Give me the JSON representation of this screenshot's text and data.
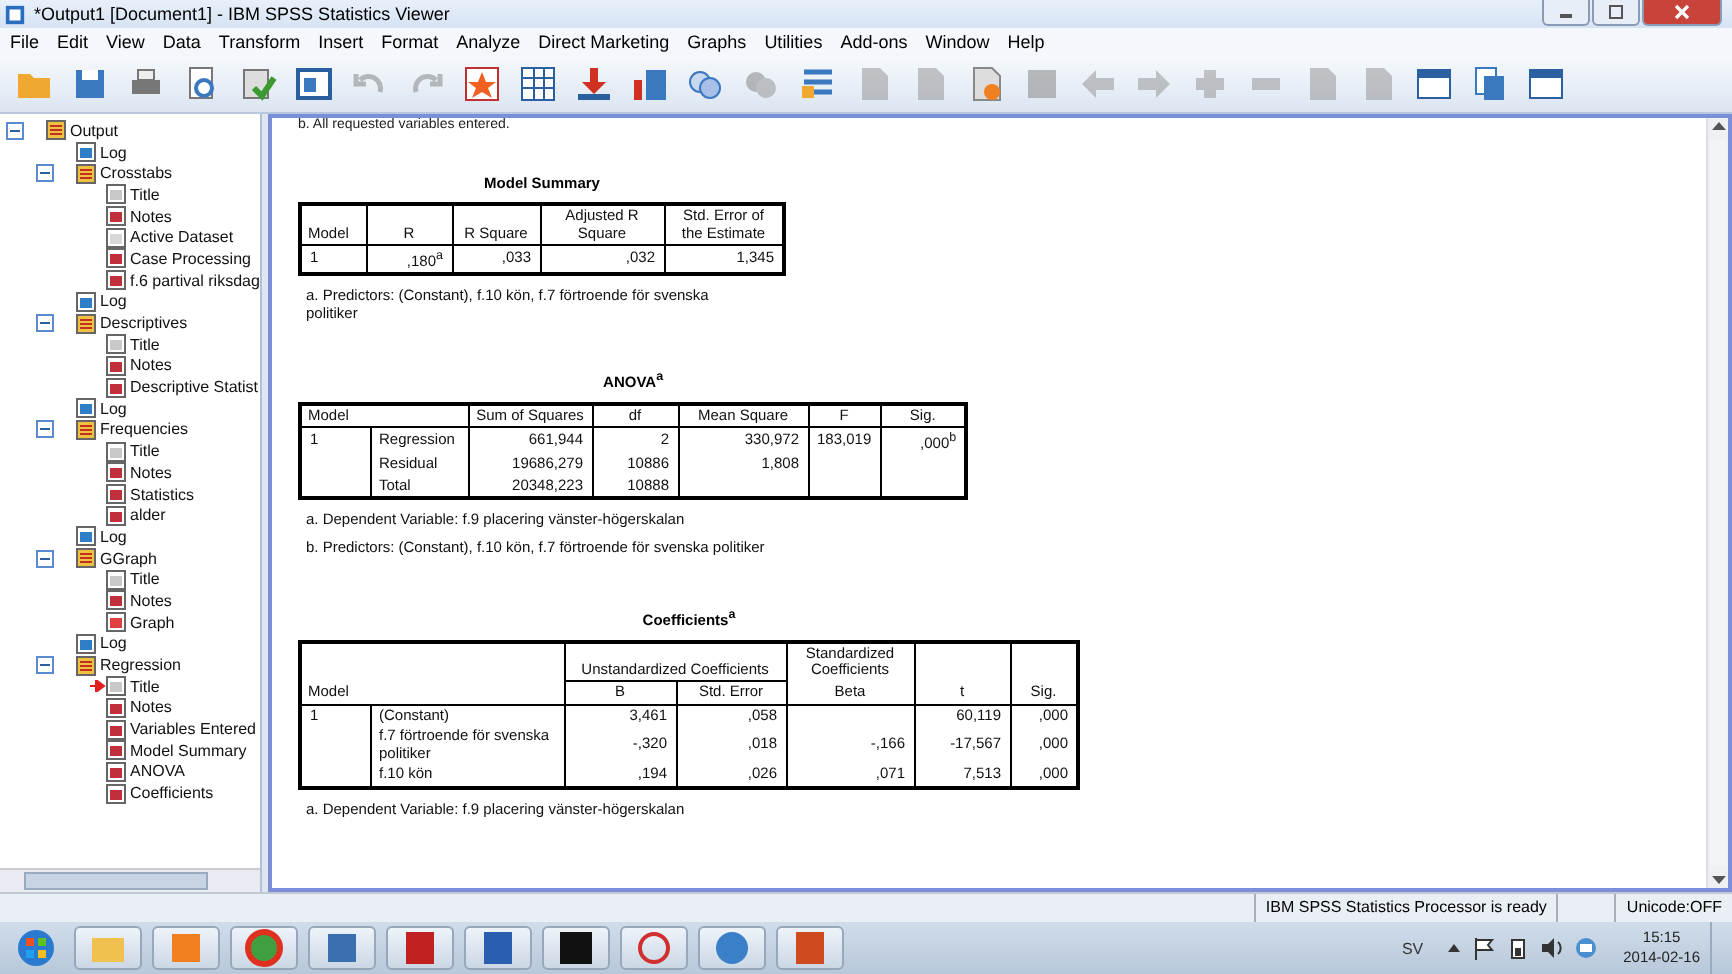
{
  "window": {
    "title": "*Output1 [Document1] - IBM SPSS Statistics Viewer"
  },
  "menu": [
    "File",
    "Edit",
    "View",
    "Data",
    "Transform",
    "Insert",
    "Format",
    "Analyze",
    "Direct Marketing",
    "Graphs",
    "Utilities",
    "Add-ons",
    "Window",
    "Help"
  ],
  "toolbar": [
    {
      "disabled": false
    },
    {
      "disabled": false
    },
    {
      "disabled": false
    },
    {
      "disabled": false
    },
    {
      "disabled": false
    },
    {
      "disabled": false
    },
    {
      "disabled": true
    },
    {
      "disabled": true
    },
    {
      "disabled": false
    },
    {
      "disabled": false
    },
    {
      "disabled": false
    },
    {
      "disabled": false
    },
    {
      "disabled": false
    },
    {
      "disabled": true
    },
    {
      "disabled": false
    },
    {
      "disabled": true
    },
    {
      "disabled": true
    },
    {
      "disabled": false
    },
    {
      "disabled": true
    },
    {
      "disabled": true
    },
    {
      "disabled": true
    },
    {
      "disabled": true
    },
    {
      "disabled": true
    },
    {
      "disabled": true
    },
    {
      "disabled": true
    },
    {
      "disabled": false
    },
    {
      "disabled": false
    },
    {
      "disabled": false
    }
  ],
  "tree": [
    {
      "label": "Output",
      "kind": "heading",
      "expanded": true,
      "current": false,
      "children": [
        {
          "label": "Log",
          "kind": "log",
          "current": false
        },
        {
          "label": "Crosstabs",
          "kind": "heading",
          "expanded": true,
          "current": false,
          "children": [
            {
              "label": "Title",
              "kind": "title",
              "current": false
            },
            {
              "label": "Notes",
              "kind": "notes",
              "current": false
            },
            {
              "label": "Active Dataset",
              "kind": "dataset",
              "current": false
            },
            {
              "label": "Case Processing",
              "kind": "table",
              "current": false
            },
            {
              "label": "f.6 partival riksdag",
              "kind": "table",
              "current": false
            }
          ]
        },
        {
          "label": "Log",
          "kind": "log",
          "current": false
        },
        {
          "label": "Descriptives",
          "kind": "heading",
          "expanded": true,
          "current": false,
          "children": [
            {
              "label": "Title",
              "kind": "title",
              "current": false
            },
            {
              "label": "Notes",
              "kind": "notes",
              "current": false
            },
            {
              "label": "Descriptive Statist",
              "kind": "table",
              "current": false
            }
          ]
        },
        {
          "label": "Log",
          "kind": "log",
          "current": false
        },
        {
          "label": "Frequencies",
          "kind": "heading",
          "expanded": true,
          "current": false,
          "children": [
            {
              "label": "Title",
              "kind": "title",
              "current": false
            },
            {
              "label": "Notes",
              "kind": "notes",
              "current": false
            },
            {
              "label": "Statistics",
              "kind": "table",
              "current": false
            },
            {
              "label": "alder",
              "kind": "table",
              "current": false
            }
          ]
        },
        {
          "label": "Log",
          "kind": "log",
          "current": false
        },
        {
          "label": "GGraph",
          "kind": "heading",
          "expanded": true,
          "current": false,
          "children": [
            {
              "label": "Title",
              "kind": "title",
              "current": false
            },
            {
              "label": "Notes",
              "kind": "notes",
              "current": false
            },
            {
              "label": "Graph",
              "kind": "chart",
              "current": false
            }
          ]
        },
        {
          "label": "Log",
          "kind": "log",
          "current": false
        },
        {
          "label": "Regression",
          "kind": "heading",
          "expanded": true,
          "current": false,
          "children": [
            {
              "label": "Title",
              "kind": "title",
              "current": true
            },
            {
              "label": "Notes",
              "kind": "notes",
              "current": false
            },
            {
              "label": "Variables Entered",
              "kind": "table",
              "current": false
            },
            {
              "label": "Model Summary",
              "kind": "table",
              "current": false
            },
            {
              "label": "ANOVA",
              "kind": "table",
              "current": false
            },
            {
              "label": "Coefficients",
              "kind": "table",
              "current": false
            }
          ]
        }
      ]
    }
  ],
  "output": {
    "cut_note": "b. All requested variables entered.",
    "tables": [
      {
        "title": "Model Summary",
        "header_rows": [
          [
            "Model",
            "R",
            "R Square",
            "Adjusted R Square",
            "Std. Error of the Estimate"
          ]
        ],
        "rows": [
          [
            "1",
            ",180$^{a}$",
            ",033",
            ",032",
            "1,345"
          ]
        ],
        "footnotes": [
          "a. Predictors: (Constant), f.10 kön, f.7 förtroende för svenska politiker"
        ]
      },
      {
        "title": "ANOVA$^{a}$",
        "header_rows": [
          [
            "Model",
            "Sum of Squares",
            "df",
            "Mean Square",
            "F",
            "Sig."
          ]
        ],
        "rows": [
          [
            "1",
            "Regression",
            "661,944",
            "2",
            "330,972",
            "183,019",
            ",000$^{b}$"
          ],
          [
            null,
            "Residual",
            "19686,279",
            "10886",
            "1,808",
            null,
            null
          ],
          [
            null,
            "Total",
            "20348,223",
            "10888",
            null,
            null,
            null
          ]
        ],
        "footnotes": [
          "a. Dependent Variable: f.9 placering vänster-högerskalan",
          "b. Predictors: (Constant), f.10 kön, f.7 förtroende för svenska politiker"
        ]
      },
      {
        "title": "Coefficients$^{a}$",
        "header_rows": [
          [
            "Model",
            "Unstandardized Coefficients",
            "Standardized Coefficients",
            "t",
            "Sig."
          ],
          [
            "B",
            "Std. Error",
            "Beta"
          ]
        ],
        "rows": [
          [
            "1",
            "(Constant)",
            "3,461",
            ",058",
            null,
            "60,119",
            ",000"
          ],
          [
            null,
            "f.7 förtroende för svenska politiker",
            "-,320",
            ",018",
            "-,166",
            "-17,567",
            ",000"
          ],
          [
            null,
            "f.10 kön",
            ",194",
            ",026",
            ",071",
            "7,513",
            ",000"
          ]
        ],
        "footnotes": [
          "a. Dependent Variable: f.9 placering vänster-högerskalan"
        ]
      }
    ]
  },
  "status_bar": {
    "message": "IBM SPSS Statistics Processor is ready",
    "encoding": "Unicode:OFF"
  },
  "taskbar": {
    "language": "SV",
    "time": "15:15",
    "date": "2014-02-16"
  }
}
